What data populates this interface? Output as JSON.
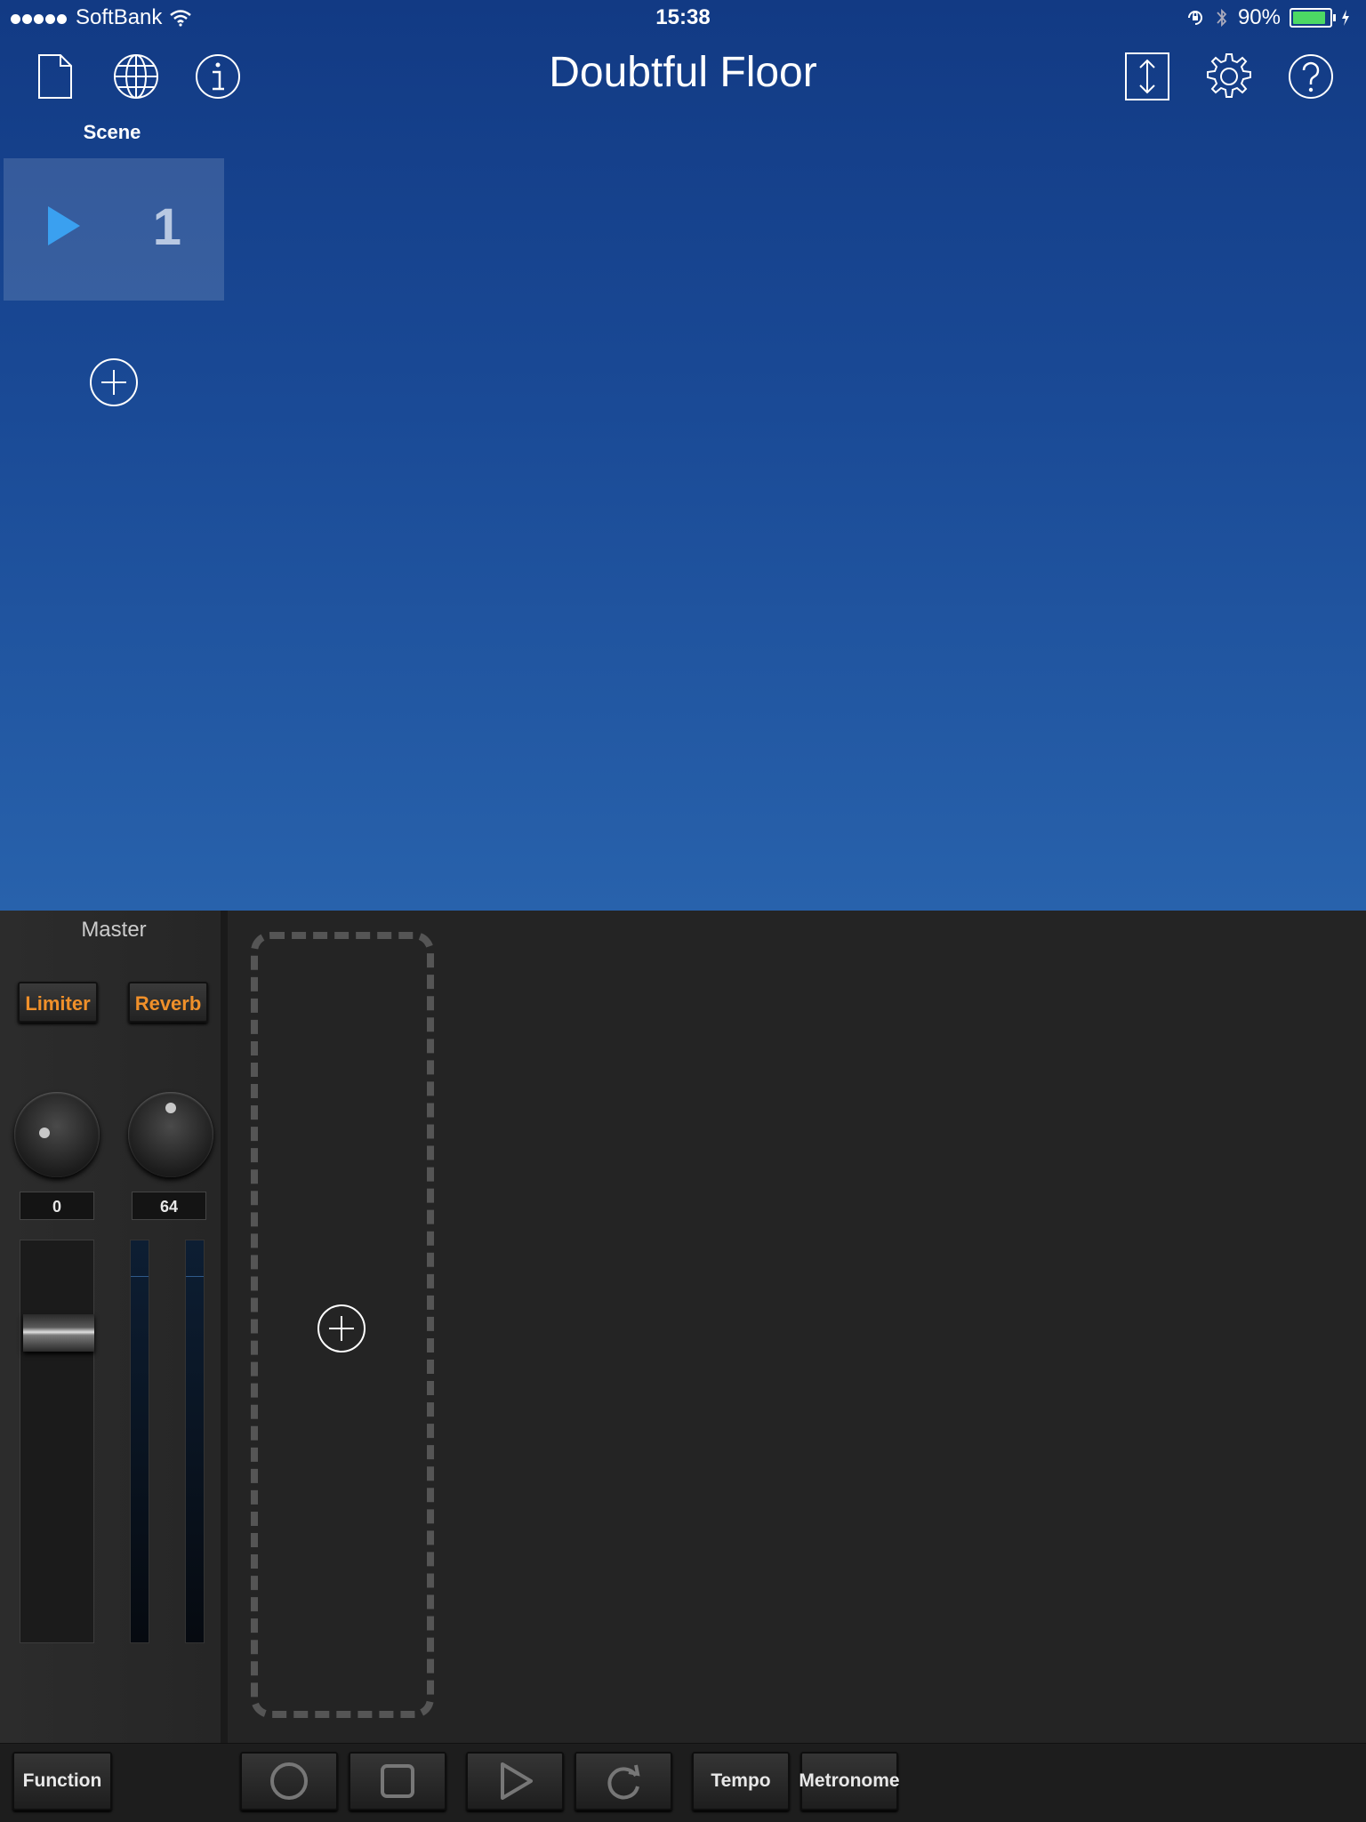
{
  "status": {
    "carrier": "SoftBank",
    "time": "15:38",
    "battery_text": "90%",
    "battery_level": 0.9,
    "battery_color": "#4cd964"
  },
  "nav": {
    "title": "Doubtful Floor",
    "icons": [
      "document-icon",
      "globe-icon",
      "info-icon",
      "resize-icon",
      "gear-icon",
      "help-icon"
    ]
  },
  "scene": {
    "label": "Scene",
    "items": [
      {
        "number": "1"
      }
    ]
  },
  "master": {
    "title": "Master",
    "limiter_label": "Limiter",
    "reverb_label": "Reverb",
    "knob1_value": "0",
    "knob2_value": "64"
  },
  "toolbar": {
    "function_label": "Function",
    "tempo_label": "Tempo",
    "metronome_label": "Metronome"
  },
  "colors": {
    "accent_orange": "#f0902a",
    "play_blue": "#3aa0f0"
  }
}
